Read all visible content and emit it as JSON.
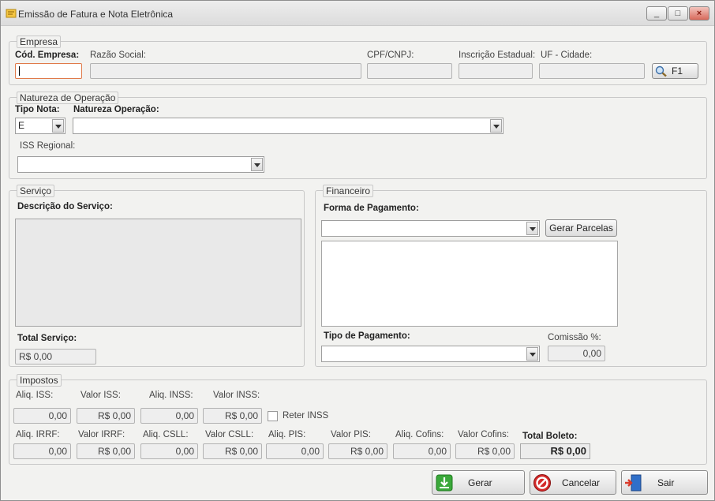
{
  "window": {
    "title": "Emissão de Fatura e Nota Eletrônica",
    "minimize_glyph": "_",
    "maximize_glyph": "□",
    "close_glyph": "×"
  },
  "empresa": {
    "legend": "Empresa",
    "cod_label": "Cód. Empresa:",
    "razao_label": "Razão Social:",
    "cpf_label": "CPF/CNPJ:",
    "ie_label": "Inscrição Estadual:",
    "uf_label": "UF - Cidade:",
    "lookup_button": "F1",
    "lookup_icon": "magnifier-icon"
  },
  "natureza": {
    "legend": "Natureza de Operação",
    "tipo_label": "Tipo Nota:",
    "tipo_value": "E",
    "natureza_label": "Natureza Operação:",
    "iss_label": "ISS Regional:"
  },
  "servico": {
    "legend": "Serviço",
    "descricao_label": "Descrição do Serviço:",
    "total_label": "Total Serviço:",
    "total_value": "R$ 0,00"
  },
  "financeiro": {
    "legend": "Financeiro",
    "forma_label": "Forma de Pagamento:",
    "gerar_parcelas": "Gerar Parcelas",
    "tipo_label": "Tipo de Pagamento:",
    "comissao_label": "Comissão %:",
    "comissao_value": "0,00"
  },
  "impostos": {
    "legend": "Impostos",
    "row1": [
      {
        "label": "Aliq. ISS:",
        "value": "0,00"
      },
      {
        "label": "Valor ISS:",
        "value": "R$ 0,00"
      },
      {
        "label": "Aliq. INSS:",
        "value": "0,00"
      },
      {
        "label": "Valor INSS:",
        "value": "R$ 0,00"
      }
    ],
    "reter_inss": "Reter INSS",
    "row2": [
      {
        "label": "Aliq. IRRF:",
        "value": "0,00"
      },
      {
        "label": "Valor IRRF:",
        "value": "R$ 0,00"
      },
      {
        "label": "Aliq. CSLL:",
        "value": "0,00"
      },
      {
        "label": "Valor CSLL:",
        "value": "R$ 0,00"
      },
      {
        "label": "Aliq. PIS:",
        "value": "0,00"
      },
      {
        "label": "Valor PIS:",
        "value": "R$ 0,00"
      },
      {
        "label": "Aliq. Cofins:",
        "value": "0,00"
      },
      {
        "label": "Valor Cofins:",
        "value": "R$ 0,00"
      }
    ],
    "total_boleto_label": "Total Boleto:",
    "total_boleto_value": "R$ 0,00"
  },
  "actions": {
    "gerar": "Gerar",
    "cancelar": "Cancelar",
    "sair": "Sair"
  },
  "colors": {
    "gerar_icon": "#3aa83a",
    "cancelar_icon": "#cc2222",
    "sair_icon": "#2f6fc9",
    "focus_border": "#e07a4a"
  }
}
